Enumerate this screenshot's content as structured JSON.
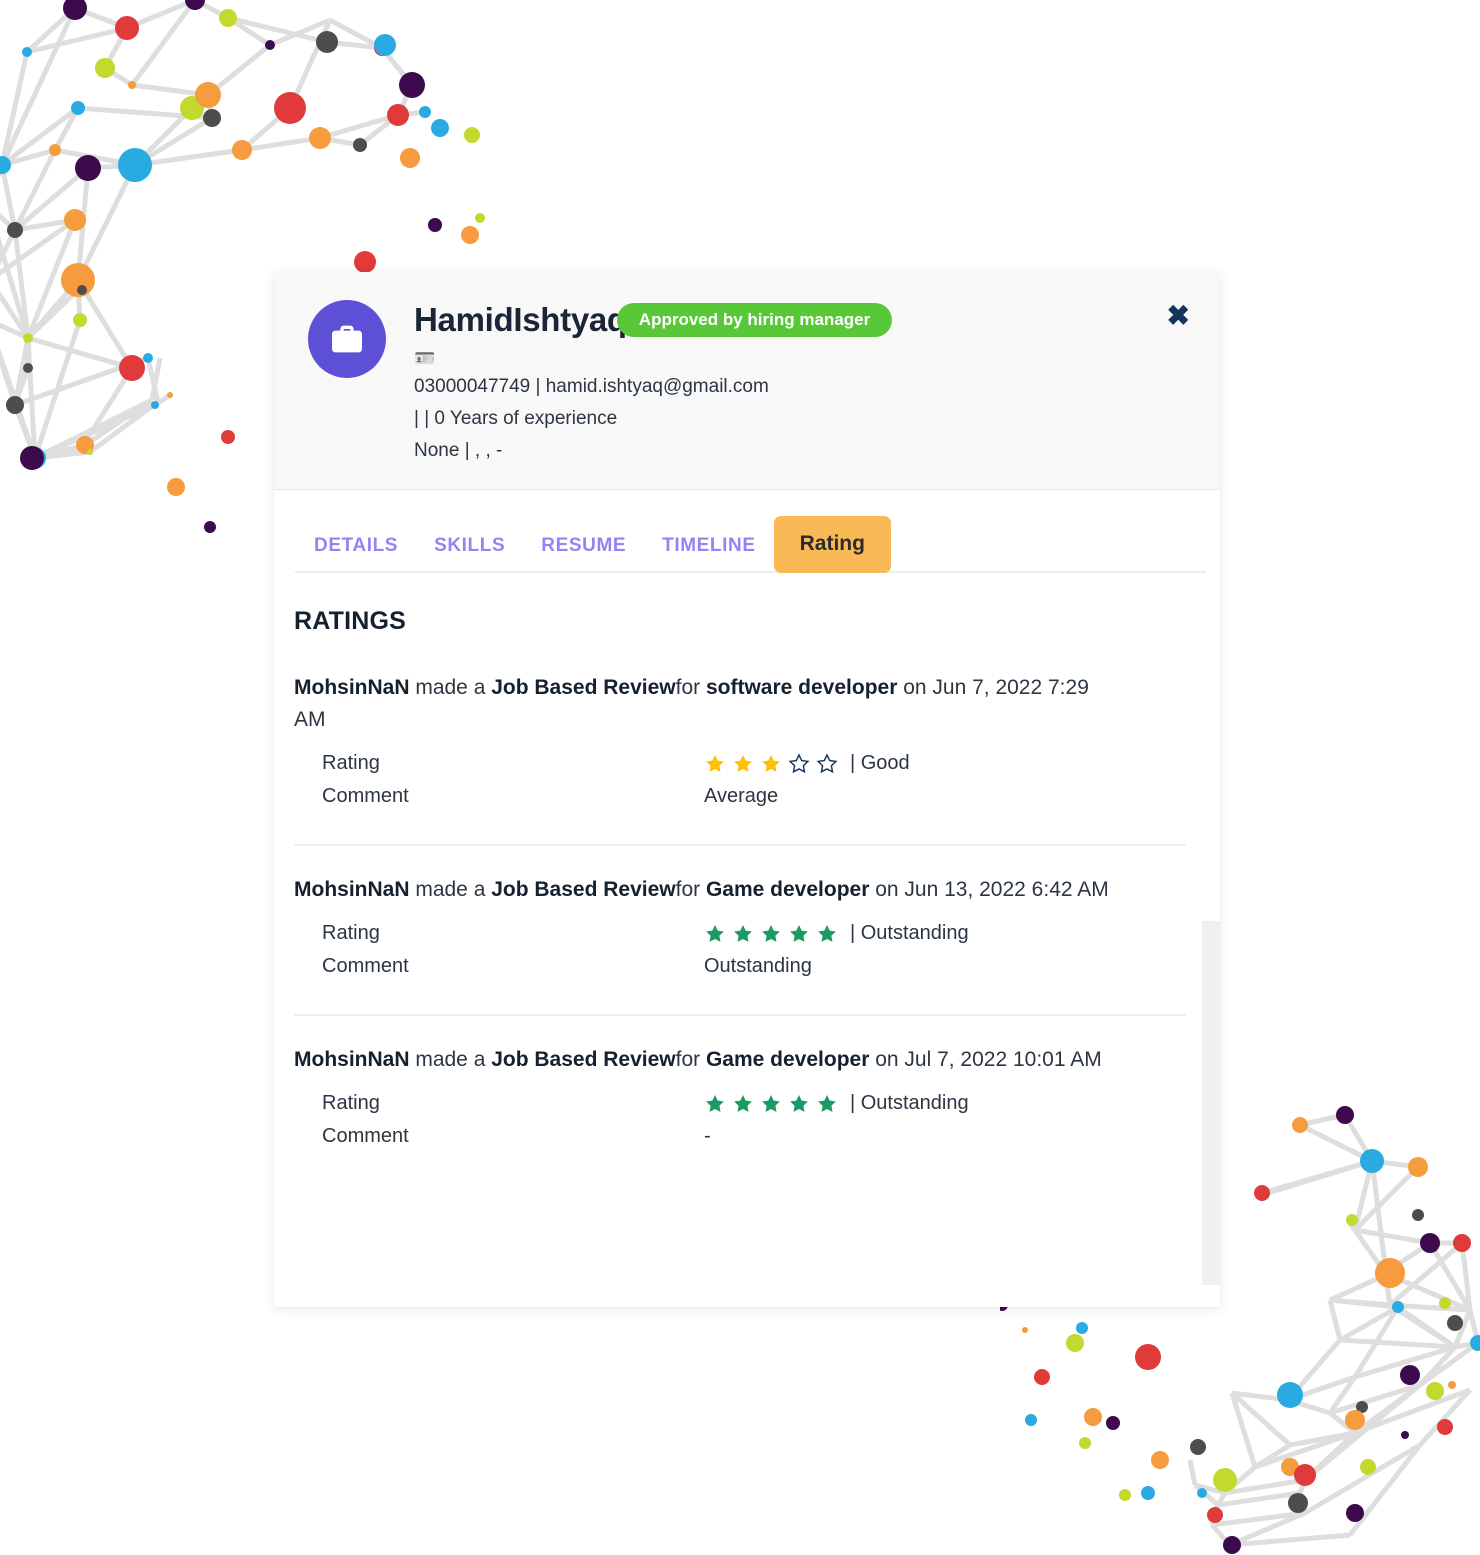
{
  "modal": {
    "close_label": "✖",
    "avatar_icon": "briefcase-icon",
    "id_badge_icon": "🪪",
    "candidate": {
      "name": "HamidIshtyaq",
      "status_badge": "Approved by hiring manager",
      "contact_line": "03000047749 | hamid.ishtyaq@gmail.com",
      "experience_line": "| | 0 Years of experience",
      "location_line": "None | , , -"
    },
    "tabs": [
      {
        "label": "DETAILS",
        "active": false
      },
      {
        "label": "SKILLS",
        "active": false
      },
      {
        "label": "RESUME",
        "active": false
      },
      {
        "label": "TIMELINE",
        "active": false
      },
      {
        "label": "Rating",
        "active": true
      }
    ],
    "ratings_section": {
      "title": "RATINGS",
      "rating_key_label": "Rating",
      "comment_key_label": "Comment",
      "reviews": [
        {
          "reviewer": "MohsinNaN",
          "made_a": " made a ",
          "review_type": "Job Based Review",
          "for": "for ",
          "job": "software developer",
          "on": " on ",
          "datetime": "Jun 7, 2022 7:29 AM",
          "stars_filled": 3,
          "stars_total": 5,
          "star_color": "#ffc107",
          "rating_word": "| Good",
          "comment": "Average"
        },
        {
          "reviewer": "MohsinNaN",
          "made_a": " made a ",
          "review_type": "Job Based Review",
          "for": "for ",
          "job": "Game developer",
          "on": " on ",
          "datetime": "Jun 13, 2022 6:42 AM",
          "stars_filled": 5,
          "stars_total": 5,
          "star_color": "#1a9b63",
          "rating_word": "| Outstanding",
          "comment": "Outstanding"
        },
        {
          "reviewer": "MohsinNaN",
          "made_a": " made a ",
          "review_type": "Job Based Review",
          "for": "for ",
          "job": "Game developer",
          "on": " on ",
          "datetime": "Jul 7, 2022 10:01 AM",
          "stars_filled": 5,
          "stars_total": 5,
          "star_color": "#1a9b63",
          "rating_word": "| Outstanding",
          "comment": "-"
        }
      ]
    }
  },
  "colors": {
    "avatar_bg": "#5d4fd6",
    "approved_green": "#58c839",
    "active_tab_orange": "#f9b954",
    "tab_purple": "#9284f5",
    "gold_star": "#ffc107",
    "green_star": "#1a9b63"
  },
  "decor": {
    "network_palette": [
      "#e03a3a",
      "#f79b3f",
      "#c3d92e",
      "#29abe2",
      "#3d0a4d",
      "#4d4d4d",
      "#a6d93c"
    ]
  }
}
